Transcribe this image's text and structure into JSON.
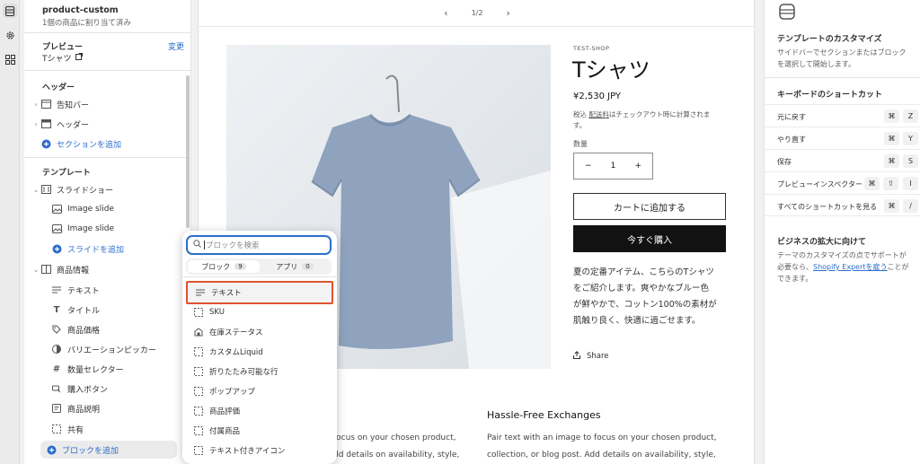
{
  "rail": {
    "icons": [
      "sections-icon",
      "settings-gear-icon",
      "apps-icon"
    ]
  },
  "sidebar": {
    "template_name": "product-custom",
    "template_sub": "1個の商品に割り当て済み",
    "preview_label": "プレビュー",
    "preview_change": "変更",
    "preview_value": "Tシャツ",
    "header_group": "ヘッダー",
    "header_items": [
      {
        "label": "告知バー",
        "icon": "announcement-icon"
      },
      {
        "label": "ヘッダー",
        "icon": "header-layout-icon"
      }
    ],
    "add_section": "セクションを追加",
    "template_group": "テンプレート",
    "slideshow": "スライドショー",
    "slides": [
      "Image slide",
      "Image slide"
    ],
    "add_slide": "スライドを追加",
    "product_info": "商品情報",
    "blocks": [
      {
        "label": "テキスト",
        "icon": "text-icon"
      },
      {
        "label": "タイトル",
        "icon": "title-icon"
      },
      {
        "label": "商品価格",
        "icon": "price-tag-icon"
      },
      {
        "label": "バリエーションピッカー",
        "icon": "variant-picker-icon"
      },
      {
        "label": "数量セレクター",
        "icon": "hashtag-icon"
      },
      {
        "label": "購入ボタン",
        "icon": "buy-button-icon"
      },
      {
        "label": "商品説明",
        "icon": "description-icon"
      },
      {
        "label": "共有",
        "icon": "share-block-icon"
      }
    ],
    "add_block": "ブロックを追加"
  },
  "preview": {
    "pager": "1/2",
    "vendor": "TEST-SHOP",
    "title": "Tシャツ",
    "price": "¥2,530 JPY",
    "tax_line1_a": "税込 ",
    "tax_line1_link": "配送料",
    "tax_line1_b": "はチェックアウト時に計算されま",
    "tax_line2": "す。",
    "quantity_label": "数量",
    "quantity_value": "1",
    "minus": "−",
    "plus": "+",
    "add_to_cart": "カートに追加する",
    "buy_now": "今すぐ購入",
    "description": [
      "夏の定番アイテム、こちらのTシャツ",
      "をご紹介します。爽やかなブルー色",
      "が鮮やかで、コットン100%の素材が",
      "肌触り良く、快適に過ごせます。"
    ],
    "share": "Share",
    "heading_right": "Hassle-Free Exchanges",
    "body_right": [
      "Pair text with an image to focus on your chosen product,",
      "collection, or blog post. Add details on availability, style,"
    ],
    "body_left": [
      "focus on your chosen product,",
      "dd details on availability, style,"
    ]
  },
  "popover": {
    "search_placeholder": "ブロックを検索",
    "tab_blocks": "ブロック",
    "tab_blocks_count": "9",
    "tab_apps": "アプリ",
    "tab_apps_count": "0",
    "items": [
      {
        "label": "テキスト",
        "icon": "text-icon",
        "selected": true
      },
      {
        "label": "SKU",
        "icon": "dashed-square-icon"
      },
      {
        "label": "在庫ステータス",
        "icon": "inventory-icon"
      },
      {
        "label": "カスタムLiquid",
        "icon": "dashed-square-icon"
      },
      {
        "label": "折りたたみ可能な行",
        "icon": "dashed-square-icon"
      },
      {
        "label": "ポップアップ",
        "icon": "dashed-square-icon"
      },
      {
        "label": "商品評価",
        "icon": "dashed-square-icon"
      },
      {
        "label": "付属商品",
        "icon": "dashed-square-icon"
      },
      {
        "label": "テキスト付きアイコン",
        "icon": "dashed-square-icon"
      }
    ]
  },
  "right_panel": {
    "customize_title": "テンプレートのカスタマイズ",
    "customize_text": "サイドバーでセクションまたはブロックを選択して開始します。",
    "shortcuts_title": "キーボードのショートカット",
    "shortcuts": [
      {
        "label": "元に戻す",
        "keys": [
          "⌘",
          "Z"
        ]
      },
      {
        "label": "やり直す",
        "keys": [
          "⌘",
          "Y"
        ]
      },
      {
        "label": "保存",
        "keys": [
          "⌘",
          "S"
        ]
      },
      {
        "label": "プレビューインスペクター",
        "keys": [
          "⌘",
          "⇧",
          "I"
        ]
      },
      {
        "label": "すべてのショートカットを見る",
        "keys": [
          "⌘",
          "/"
        ]
      }
    ],
    "grow_title": "ビジネスの拡大に向けて",
    "grow_text_a": "テーマのカスタマイズの点でサポートが必要なら、",
    "grow_link": "Shopify Expertを雇う",
    "grow_text_b": "ことができます。"
  },
  "colors": {
    "accent": "#2c6ecb",
    "selected_outline": "#e0522d",
    "buy_now": "#121212",
    "focus_ring": "#2c6ecb"
  }
}
